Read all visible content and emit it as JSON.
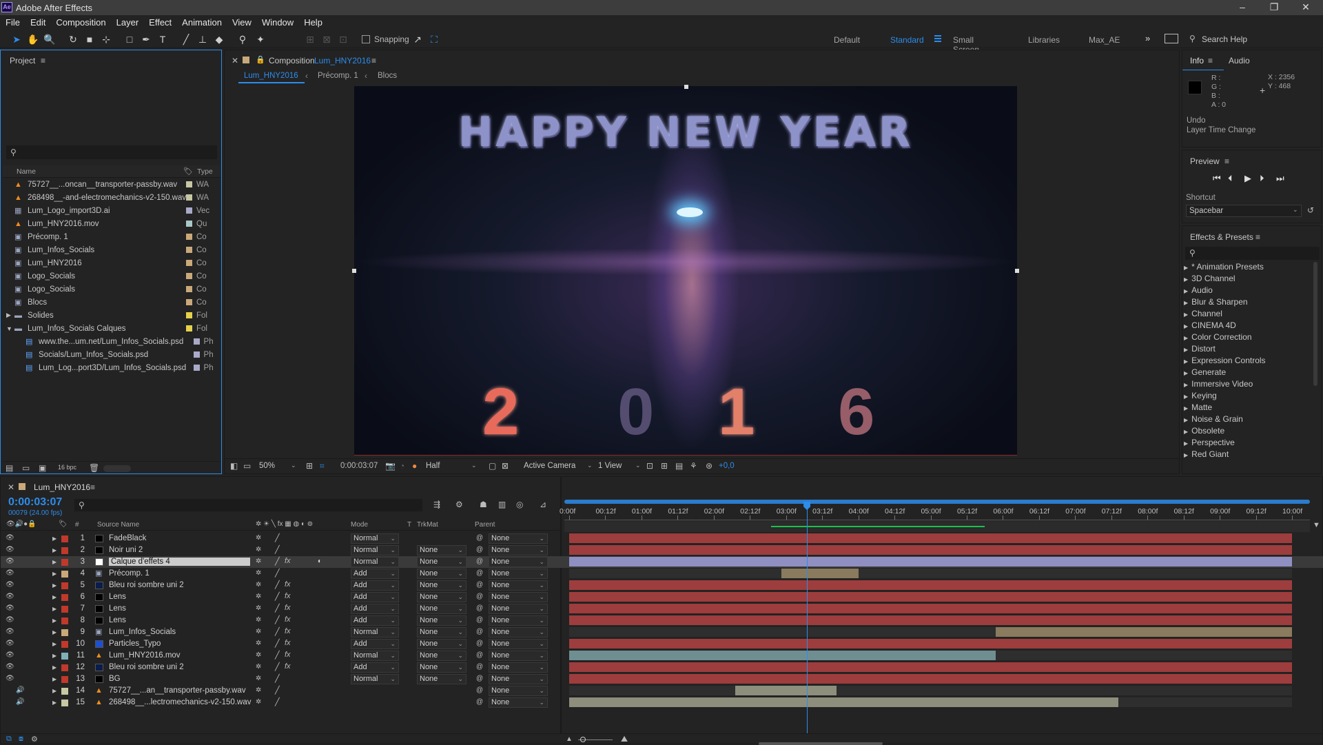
{
  "app": {
    "title": "Adobe After Effects",
    "logo": "Ae"
  },
  "menu": [
    "File",
    "Edit",
    "Composition",
    "Layer",
    "Effect",
    "Animation",
    "View",
    "Window",
    "Help"
  ],
  "toolbar": {
    "snapping": "Snapping",
    "workspaces": [
      "Default",
      "Standard",
      "Small Screen",
      "Libraries",
      "Max_AE"
    ],
    "active_workspace": "Standard",
    "search_placeholder": "Search Help"
  },
  "project": {
    "title": "Project",
    "columns": {
      "name": "Name",
      "type": "Type"
    },
    "items": [
      {
        "name": "75727__...oncan__transporter-passby.wav",
        "type": "WA",
        "icon": "audio-file-icon",
        "color": "#c7c7a3",
        "indent": 0
      },
      {
        "name": "268498__-and-electromechanics-v2-150.wav",
        "type": "WA",
        "icon": "audio-file-icon",
        "color": "#c7c7a3",
        "indent": 0
      },
      {
        "name": "Lum_Logo_import3D.ai",
        "type": "Vec",
        "icon": "illustrator-file-icon",
        "color": "#a9a9c9",
        "indent": 0
      },
      {
        "name": "Lum_HNY2016.mov",
        "type": "Qu",
        "icon": "footage-file-icon",
        "color": "#a9c7c7",
        "indent": 0
      },
      {
        "name": "Précomp. 1",
        "type": "Co",
        "icon": "composition-icon",
        "color": "#c9a97a",
        "indent": 0
      },
      {
        "name": "Lum_Infos_Socials",
        "type": "Co",
        "icon": "composition-icon",
        "color": "#c9a97a",
        "indent": 0
      },
      {
        "name": "Lum_HNY2016",
        "type": "Co",
        "icon": "composition-icon",
        "color": "#c9a97a",
        "indent": 0
      },
      {
        "name": "Logo_Socials",
        "type": "Co",
        "icon": "composition-icon",
        "color": "#c9a97a",
        "indent": 0
      },
      {
        "name": "Logo_Socials",
        "type": "Co",
        "icon": "composition-icon",
        "color": "#c9a97a",
        "indent": 0
      },
      {
        "name": "Blocs",
        "type": "Co",
        "icon": "composition-icon",
        "color": "#c9a97a",
        "indent": 0
      },
      {
        "name": "Solides",
        "type": "Fol",
        "icon": "folder-icon",
        "color": "#e6d24a",
        "indent": 0
      },
      {
        "name": "Lum_Infos_Socials Calques",
        "type": "Fol",
        "icon": "folder-icon",
        "color": "#e6d24a",
        "indent": 0
      },
      {
        "name": "www.the...um.net/Lum_Infos_Socials.psd",
        "type": "Ph",
        "icon": "photoshop-file-icon",
        "color": "#a9a9c9",
        "indent": 1
      },
      {
        "name": "Socials/Lum_Infos_Socials.psd",
        "type": "Ph",
        "icon": "photoshop-file-icon",
        "color": "#a9a9c9",
        "indent": 1
      },
      {
        "name": "Lum_Log...port3D/Lum_Infos_Socials.psd",
        "type": "Ph",
        "icon": "photoshop-file-icon",
        "color": "#a9a9c9",
        "indent": 1
      }
    ],
    "bpc": "16 bpc"
  },
  "composition": {
    "panel_label": "Composition",
    "name": "Lum_HNY2016",
    "breadcrumbs": [
      "Lum_HNY2016",
      "Précomp. 1",
      "Blocs"
    ],
    "viewer_text": {
      "headline": "HAPPY NEW YEAR",
      "digits": [
        "2",
        "0",
        "1",
        "6"
      ]
    },
    "zoom": "50%",
    "time": "0:00:03:07",
    "resolution": "Half",
    "camera": "Active Camera",
    "views": "1 View",
    "exposure": "+0,0"
  },
  "info": {
    "tabs": [
      "Info",
      "Audio"
    ],
    "labels": [
      "R :",
      "G :",
      "B :",
      "A : 0"
    ],
    "x": "X : 2356",
    "y": "Y : 468",
    "undo_title": "Undo",
    "undo_action": "Layer Time Change"
  },
  "preview": {
    "title": "Preview",
    "shortcut_label": "Shortcut",
    "shortcut": "Spacebar"
  },
  "effects": {
    "title": "Effects & Presets",
    "items": [
      "* Animation Presets",
      "3D Channel",
      "Audio",
      "Blur & Sharpen",
      "Channel",
      "CINEMA 4D",
      "Color Correction",
      "Distort",
      "Expression Controls",
      "Generate",
      "Immersive Video",
      "Keying",
      "Matte",
      "Noise & Grain",
      "Obsolete",
      "Perspective",
      "Red Giant"
    ]
  },
  "timeline": {
    "comp_name": "Lum_HNY2016",
    "current_time": "0:00:03:07",
    "frame_info": "00079 (24.00 fps)",
    "columns": {
      "number": "#",
      "source": "Source Name",
      "mode": "Mode",
      "t": "T",
      "trkmat": "TrkMat",
      "parent": "Parent"
    },
    "ruler": [
      "0:00f",
      "00:12f",
      "01:00f",
      "01:12f",
      "02:00f",
      "02:12f",
      "03:00f",
      "03:12f",
      "04:00f",
      "04:12f",
      "05:00f",
      "05:12f",
      "06:00f",
      "06:12f",
      "07:00f",
      "07:12f",
      "08:00f",
      "08:12f",
      "09:00f",
      "09:12f",
      "10:00f"
    ],
    "playhead_seconds": 3.29,
    "duration_seconds": 10,
    "layers": [
      {
        "num": "1",
        "name": "FadeBlack",
        "label": "#c0392b",
        "icon": "#000000",
        "mode": "Normal",
        "trkmat": "",
        "parent": "None",
        "fx": false,
        "bar": {
          "start": 0,
          "end": 10,
          "color": "#9e3d3d"
        },
        "visible": true
      },
      {
        "num": "2",
        "name": "Noir uni 2",
        "label": "#c0392b",
        "icon": "#000000",
        "mode": "Normal",
        "trkmat": "None",
        "parent": "None",
        "fx": false,
        "bar": {
          "start": 0,
          "end": 10,
          "color": "#9e3d3d"
        },
        "visible": true
      },
      {
        "num": "3",
        "name": "Calque d'effets 4",
        "label": "#c0392b",
        "icon": "#ffffff",
        "mode": "Normal",
        "trkmat": "None",
        "parent": "None",
        "fx": true,
        "bar": {
          "start": 0,
          "end": 10,
          "color": "#8f8fc2"
        },
        "visible": true,
        "selected": true
      },
      {
        "num": "4",
        "name": "Précomp. 1",
        "label": "#c9a97a",
        "icon": "comp",
        "mode": "Add",
        "trkmat": "None",
        "parent": "None",
        "fx": false,
        "bar": {
          "start": 2.94,
          "end": 4.0,
          "color": "#8a7a5e"
        },
        "visible": true
      },
      {
        "num": "5",
        "name": "Bleu roi sombre uni 2",
        "label": "#c0392b",
        "icon": "#0b1c4a",
        "mode": "Add",
        "trkmat": "None",
        "parent": "None",
        "fx": true,
        "bar": {
          "start": 0,
          "end": 10,
          "color": "#9e3d3d"
        },
        "visible": true
      },
      {
        "num": "6",
        "name": "Lens",
        "label": "#c0392b",
        "icon": "#000000",
        "mode": "Add",
        "trkmat": "None",
        "parent": "None",
        "fx": true,
        "bar": {
          "start": 0,
          "end": 10,
          "color": "#9e3d3d"
        },
        "visible": true
      },
      {
        "num": "7",
        "name": "Lens",
        "label": "#c0392b",
        "icon": "#000000",
        "mode": "Add",
        "trkmat": "None",
        "parent": "None",
        "fx": true,
        "bar": {
          "start": 0,
          "end": 10,
          "color": "#9e3d3d"
        },
        "visible": true
      },
      {
        "num": "8",
        "name": "Lens",
        "label": "#c0392b",
        "icon": "#000000",
        "mode": "Add",
        "trkmat": "None",
        "parent": "None",
        "fx": true,
        "bar": {
          "start": 0,
          "end": 10,
          "color": "#9e3d3d"
        },
        "visible": true
      },
      {
        "num": "9",
        "name": "Lum_Infos_Socials",
        "label": "#c9a97a",
        "icon": "comp",
        "mode": "Normal",
        "trkmat": "None",
        "parent": "None",
        "fx": true,
        "bar": {
          "start": 5.9,
          "end": 10,
          "color": "#8a7a5e"
        },
        "visible": true
      },
      {
        "num": "10",
        "name": "Particles_Typo",
        "label": "#c0392b",
        "icon": "#1a4fd6",
        "mode": "Add",
        "trkmat": "None",
        "parent": "None",
        "fx": true,
        "bar": {
          "start": 0,
          "end": 10,
          "color": "#9e3d3d"
        },
        "visible": true
      },
      {
        "num": "11",
        "name": "Lum_HNY2016.mov",
        "label": "#7fb0b5",
        "icon": "footage",
        "mode": "Normal",
        "trkmat": "None",
        "parent": "None",
        "fx": true,
        "bar": {
          "start": 0,
          "end": 5.9,
          "color": "#6f8e92"
        },
        "visible": true
      },
      {
        "num": "12",
        "name": "Bleu roi sombre uni 2",
        "label": "#c0392b",
        "icon": "#0b1c4a",
        "mode": "Add",
        "trkmat": "None",
        "parent": "None",
        "fx": true,
        "bar": {
          "start": 0,
          "end": 10,
          "color": "#9e3d3d"
        },
        "visible": true
      },
      {
        "num": "13",
        "name": "BG",
        "label": "#c0392b",
        "icon": "#000000",
        "mode": "Normal",
        "trkmat": "None",
        "parent": "None",
        "fx": false,
        "bar": {
          "start": 0,
          "end": 10,
          "color": "#9e3d3d"
        },
        "visible": true
      },
      {
        "num": "14",
        "name": "75727__...an__transporter-passby.wav",
        "label": "#c7c7a3",
        "icon": "audio",
        "mode": "",
        "trkmat": "",
        "parent": "None",
        "fx": false,
        "bar": {
          "start": 2.3,
          "end": 3.7,
          "color": "#8e8e7c"
        },
        "visible": false
      },
      {
        "num": "15",
        "name": "268498__...lectromechanics-v2-150.wav",
        "label": "#c7c7a3",
        "icon": "audio",
        "mode": "",
        "trkmat": "",
        "parent": "None",
        "fx": false,
        "bar": {
          "start": 0,
          "end": 7.6,
          "color": "#8e8e7c"
        },
        "visible": false
      }
    ]
  },
  "colors": {
    "accent": "#2d8ceb",
    "panel": "#232323",
    "timecode": "#2d8ceb"
  }
}
